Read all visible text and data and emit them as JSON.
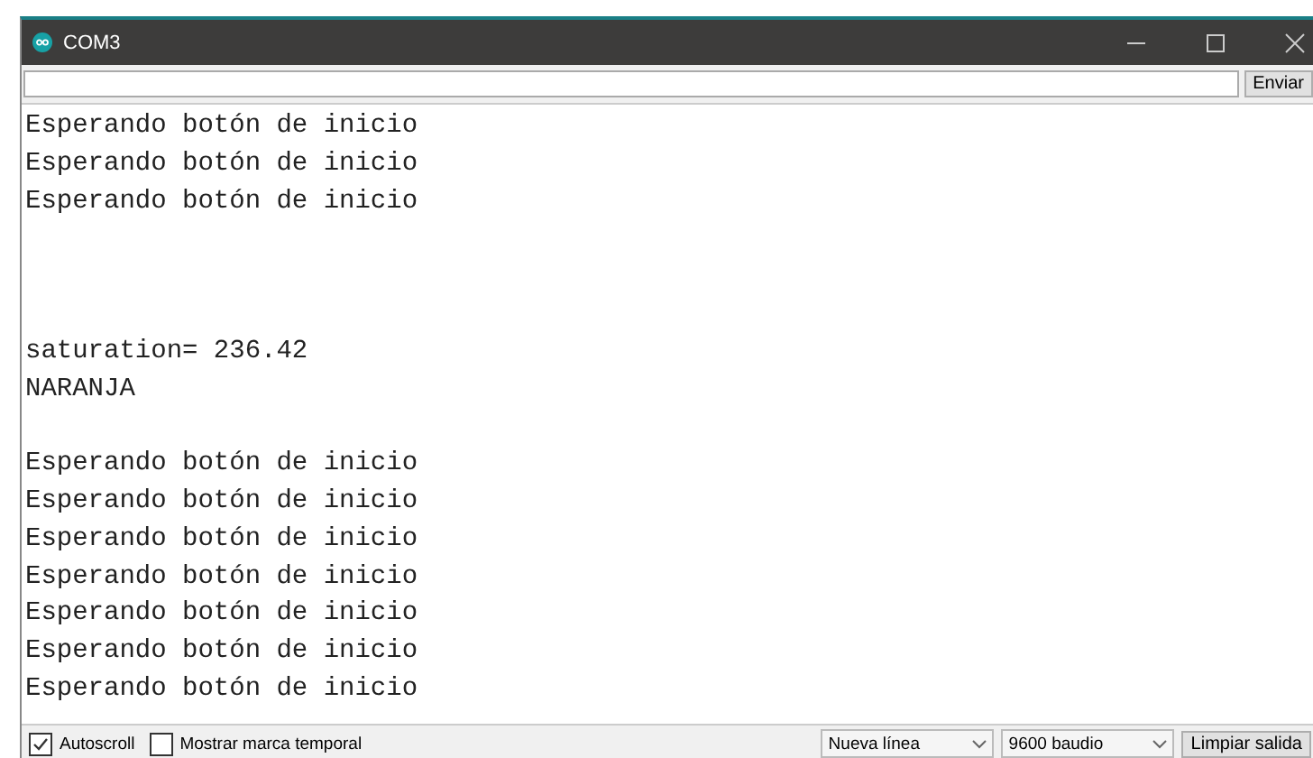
{
  "window": {
    "title": "COM3"
  },
  "send": {
    "button": "Enviar"
  },
  "output": [
    {
      "kind": "text",
      "text": "Esperando botón de inicio"
    },
    {
      "kind": "text",
      "text": "Esperando botón de inicio"
    },
    {
      "kind": "text",
      "text": "Esperando botón de inicio"
    },
    {
      "kind": "blank"
    },
    {
      "kind": "blank"
    },
    {
      "kind": "blank"
    },
    {
      "kind": "text",
      "text": "saturation= 236.42"
    },
    {
      "kind": "text",
      "text": "NARANJA"
    },
    {
      "kind": "blank"
    },
    {
      "kind": "text",
      "text": "Esperando botón de inicio"
    },
    {
      "kind": "text",
      "text": "Esperando botón de inicio"
    },
    {
      "kind": "text",
      "text": "Esperando botón de inicio"
    },
    {
      "kind": "text",
      "text": "Esperando botón de inicio"
    },
    {
      "kind": "text",
      "text": "Esperando botón de inicio"
    },
    {
      "kind": "text",
      "text": "Esperando botón de inicio"
    },
    {
      "kind": "text",
      "text": "Esperando botón de inicio"
    }
  ],
  "footer": {
    "checkboxes": [
      {
        "label": "Autoscroll",
        "checked": true
      },
      {
        "label": "Mostrar marca temporal",
        "checked": false
      }
    ],
    "dropdowns": [
      "Nueva línea",
      "9600 baudio"
    ],
    "button": "Limpiar salida"
  }
}
